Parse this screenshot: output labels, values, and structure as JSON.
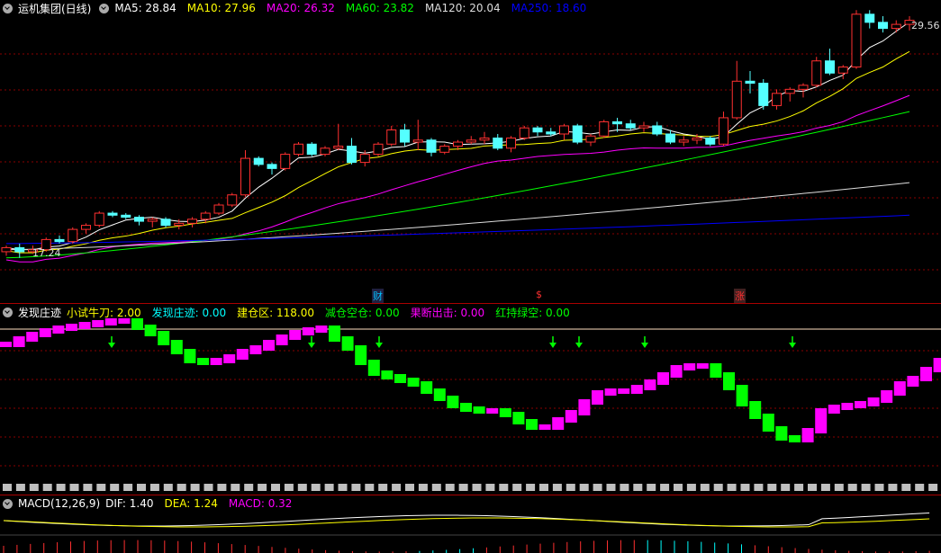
{
  "main": {
    "stock_name": "运机集团(日线)",
    "ma": [
      {
        "label": "MA5: 28.84",
        "color": "#ffffff"
      },
      {
        "label": "MA10: 27.96",
        "color": "#ffff00"
      },
      {
        "label": "MA20: 26.32",
        "color": "#ff00ff"
      },
      {
        "label": "MA60: 23.82",
        "color": "#00ff00"
      },
      {
        "label": "MA120: 20.04",
        "color": "#dddddd"
      },
      {
        "label": "MA250: 18.60",
        "color": "#0000ff"
      }
    ],
    "high_label": "29.56",
    "low_label": "17.24",
    "markers": [
      {
        "text": "财",
        "color": "#00c0ff"
      },
      {
        "text": "$",
        "color": "#ff3030"
      },
      {
        "text": "涨",
        "color": "#ff3030"
      }
    ]
  },
  "indicator": {
    "name": "发现庄迹",
    "items": [
      {
        "label": "小试牛刀: 2.00",
        "color": "#ffff00"
      },
      {
        "label": "发现庄迹: 0.00",
        "color": "#00ffff"
      },
      {
        "label": "建仓区: 118.00",
        "color": "#ffff00"
      },
      {
        "label": "减仓空仓: 0.00",
        "color": "#00ff00"
      },
      {
        "label": "果断出击: 0.00",
        "color": "#ff00ff"
      },
      {
        "label": "红持绿空: 0.00",
        "color": "#00ff00"
      }
    ]
  },
  "macd": {
    "name": "MACD(12,26,9)",
    "items": [
      {
        "label": "DIF: 1.40",
        "color": "#ffffff"
      },
      {
        "label": "DEA: 1.24",
        "color": "#ffff00"
      },
      {
        "label": "MACD: 0.32",
        "color": "#ff00ff"
      }
    ]
  },
  "chart_data": {
    "type": "candlestick",
    "note_series": "daily OHLC price chart with moving averages; values estimated from pixels",
    "candles_ohlc": [
      [
        17.6,
        17.9,
        17.4,
        17.8
      ],
      [
        17.8,
        18.0,
        17.3,
        17.6
      ],
      [
        17.6,
        17.9,
        17.5,
        17.7
      ],
      [
        17.7,
        18.3,
        17.6,
        18.2
      ],
      [
        18.2,
        18.4,
        18.0,
        18.1
      ],
      [
        18.1,
        18.8,
        18.0,
        18.7
      ],
      [
        18.7,
        19.0,
        18.5,
        18.9
      ],
      [
        18.9,
        19.6,
        18.8,
        19.5
      ],
      [
        19.5,
        19.6,
        19.3,
        19.4
      ],
      [
        19.4,
        19.5,
        19.2,
        19.3
      ],
      [
        19.3,
        19.4,
        18.9,
        19.1
      ],
      [
        19.1,
        19.3,
        18.8,
        19.2
      ],
      [
        19.2,
        19.3,
        18.8,
        18.9
      ],
      [
        18.9,
        19.2,
        18.7,
        19.0
      ],
      [
        19.0,
        19.3,
        18.8,
        19.2
      ],
      [
        19.2,
        19.6,
        19.0,
        19.5
      ],
      [
        19.5,
        20.0,
        19.4,
        19.9
      ],
      [
        19.9,
        20.5,
        19.8,
        20.4
      ],
      [
        20.4,
        22.6,
        20.3,
        22.2
      ],
      [
        22.2,
        22.3,
        21.8,
        21.9
      ],
      [
        21.9,
        22.0,
        21.4,
        21.7
      ],
      [
        21.7,
        22.5,
        21.6,
        22.4
      ],
      [
        22.4,
        23.0,
        22.3,
        22.9
      ],
      [
        22.9,
        23.0,
        22.3,
        22.4
      ],
      [
        22.4,
        22.8,
        22.3,
        22.7
      ],
      [
        22.7,
        23.9,
        22.6,
        22.8
      ],
      [
        22.8,
        23.2,
        21.9,
        22.0
      ],
      [
        22.0,
        22.6,
        21.8,
        22.4
      ],
      [
        22.4,
        23.0,
        22.3,
        22.9
      ],
      [
        22.9,
        23.8,
        22.8,
        23.6
      ],
      [
        23.6,
        23.9,
        22.8,
        23.0
      ],
      [
        23.0,
        24.1,
        22.6,
        23.1
      ],
      [
        23.1,
        23.2,
        22.3,
        22.5
      ],
      [
        22.5,
        22.9,
        22.4,
        22.8
      ],
      [
        22.8,
        23.1,
        22.6,
        23.0
      ],
      [
        23.0,
        23.3,
        22.9,
        23.1
      ],
      [
        23.1,
        23.5,
        22.9,
        23.2
      ],
      [
        23.2,
        23.4,
        22.6,
        22.7
      ],
      [
        22.7,
        23.3,
        22.5,
        23.2
      ],
      [
        23.2,
        23.8,
        23.1,
        23.7
      ],
      [
        23.7,
        23.8,
        23.3,
        23.5
      ],
      [
        23.5,
        23.7,
        23.3,
        23.4
      ],
      [
        23.4,
        23.9,
        23.1,
        23.8
      ],
      [
        23.8,
        23.9,
        22.9,
        23.0
      ],
      [
        23.0,
        23.4,
        22.8,
        23.3
      ],
      [
        23.3,
        24.1,
        23.2,
        24.0
      ],
      [
        24.0,
        24.2,
        23.5,
        23.9
      ],
      [
        23.9,
        24.1,
        23.6,
        23.7
      ],
      [
        23.7,
        24.0,
        23.5,
        23.8
      ],
      [
        23.8,
        24.0,
        23.3,
        23.4
      ],
      [
        23.4,
        23.6,
        22.9,
        23.0
      ],
      [
        23.0,
        23.3,
        22.8,
        23.1
      ],
      [
        23.1,
        23.4,
        22.9,
        23.2
      ],
      [
        23.2,
        23.3,
        22.8,
        22.9
      ],
      [
        22.9,
        24.5,
        22.8,
        24.2
      ],
      [
        24.2,
        27.0,
        24.1,
        26.0
      ],
      [
        26.0,
        26.5,
        25.4,
        25.9
      ],
      [
        25.9,
        26.1,
        24.6,
        24.8
      ],
      [
        24.8,
        25.6,
        24.6,
        25.4
      ],
      [
        25.4,
        25.7,
        25.0,
        25.6
      ],
      [
        25.6,
        25.9,
        25.2,
        25.8
      ],
      [
        25.8,
        27.2,
        25.7,
        27.0
      ],
      [
        27.0,
        27.6,
        26.3,
        26.4
      ],
      [
        26.4,
        26.8,
        26.1,
        26.7
      ],
      [
        26.7,
        29.5,
        26.6,
        29.3
      ],
      [
        29.3,
        29.5,
        28.6,
        28.9
      ],
      [
        28.9,
        29.2,
        28.4,
        28.6
      ],
      [
        28.6,
        29.0,
        28.4,
        28.8
      ],
      [
        28.8,
        29.2,
        28.5,
        29.0
      ]
    ],
    "ma_labels": [
      "MA5",
      "MA10",
      "MA20",
      "MA60",
      "MA120",
      "MA250"
    ]
  }
}
